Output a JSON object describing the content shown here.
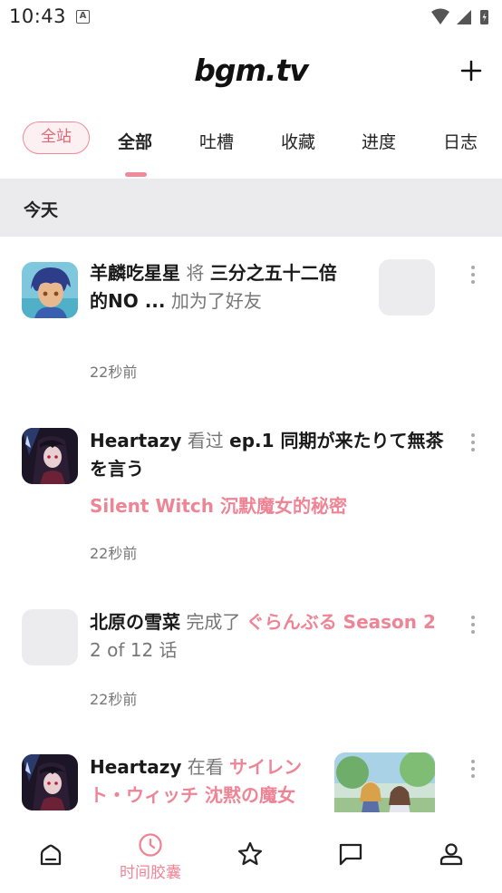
{
  "status_bar": {
    "time": "10:43",
    "notification_icon": "A"
  },
  "header": {
    "logo": "bgm.tv"
  },
  "tabs": {
    "chip_label": "全站",
    "items": [
      {
        "label": "全部",
        "active": true
      },
      {
        "label": "吐槽",
        "active": false
      },
      {
        "label": "收藏",
        "active": false
      },
      {
        "label": "进度",
        "active": false
      },
      {
        "label": "日志",
        "active": false
      }
    ]
  },
  "section": {
    "title": "今天"
  },
  "feed": [
    {
      "user": "羊麟吃星星",
      "verb": "将",
      "object": "三分之五十二倍",
      "object_cont": "的NO ...",
      "action": "加为了好友",
      "time": "22秒前"
    },
    {
      "user": "Heartazy",
      "verb": "看过",
      "episode": "ep.1 同期が来たりて無茶",
      "episode_cont": "を言う",
      "subject": "Silent Witch 沉默魔女的秘密",
      "time": "22秒前"
    },
    {
      "user": "北原の雪菜",
      "verb": "完成了",
      "subject": "ぐらんぶる Season 2",
      "progress": "2 of 12 话",
      "time": "22秒前"
    },
    {
      "user": "Heartazy",
      "verb": "在看",
      "subject": "サイレン",
      "subject_cont": "ト・ウィッチ 沈黙の魔女"
    }
  ],
  "bottom_nav": {
    "items": [
      {
        "name": "home-icon",
        "label": ""
      },
      {
        "name": "clock-icon",
        "label": "时间胶囊"
      },
      {
        "name": "star-icon",
        "label": ""
      },
      {
        "name": "chat-icon",
        "label": ""
      },
      {
        "name": "user-icon",
        "label": ""
      }
    ]
  },
  "colors": {
    "accent": "#ee8596",
    "section_bg": "#ebebed",
    "muted": "#777777"
  }
}
